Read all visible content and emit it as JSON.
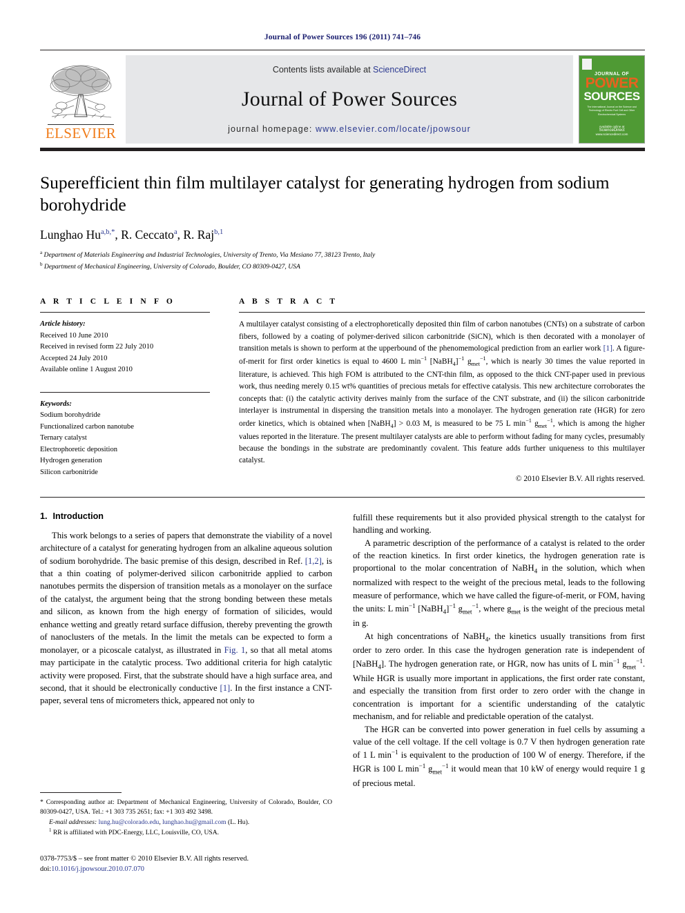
{
  "running_head": "Journal of Power Sources 196 (2011) 741–746",
  "masthead": {
    "publisher_name": "ELSEVIER",
    "contents_prefix": "Contents lists available at ",
    "sciencedirect": "ScienceDirect",
    "journal_title": "Journal of Power Sources",
    "homepage_label": "journal homepage:",
    "homepage_url": "www.elsevier.com/locate/jpowsour",
    "cover": {
      "line1": "JOURNAL OF",
      "line2": "POWER",
      "line3": "SOURCES",
      "subtitle": "The International Journal on the Science and Technology of Electro Fuel Cell and Other Electrochemical Systems",
      "footer_top": "Available online at",
      "footer_main": "ScienceDirect",
      "footer_bottom": "www.sciencedirect.com"
    }
  },
  "article": {
    "title": "Superefficient thin film multilayer catalyst for generating hydrogen from sodium borohydride",
    "authors_html": "Lunghao Hu<sup>a,b,*</sup>, R. Ceccato<sup>a</sup>, R. Raj<sup>b,1</sup>",
    "affiliations": [
      "Department of Materials Engineering and Industrial Technologies, University of Trento, Via Mesiano 77, 38123 Trento, Italy",
      "Department of Mechanical Engineering, University of Colorado, Boulder, CO 80309-0427, USA"
    ],
    "affiliation_marks": [
      "a",
      "b"
    ]
  },
  "article_info": {
    "heading": "A R T I C L E    I N F O",
    "history_label": "Article history:",
    "history": [
      "Received 10 June 2010",
      "Received in revised form 22 July 2010",
      "Accepted 24 July 2010",
      "Available online 1 August 2010"
    ],
    "keywords_label": "Keywords:",
    "keywords": [
      "Sodium borohydride",
      "Functionalized carbon nanotube",
      "Ternary catalyst",
      "Electrophoretic deposition",
      "Hydrogen generation",
      "Silicon carbonitride"
    ]
  },
  "abstract": {
    "heading": "A B S T R A C T",
    "html": "A multilayer catalyst consisting of a electrophoretically deposited thin film of carbon nanotubes (CNTs) on a substrate of carbon fibers, followed by a coating of polymer-derived silicon carbonitride (SiCN), which is then decorated with a monolayer of transition metals is shown to perform at the upperbound of the phenomemological prediction from an earlier work <a href=\"#\">[1]</a>. A figure-of-merit for first order kinetics is equal to 4600 L min<sup>−1</sup> [NaBH<sub>4</sub>]<sup>−1</sup> g<sub>met</sub><sup>−1</sup>, which is nearly 30 times the value reported in literature, is achieved. This high FOM is attributed to the CNT-thin film, as opposed to the thick CNT-paper used in previous work, thus needing merely 0.15 wt% quantities of precious metals for effective catalysis. This new architecture corroborates the concepts that: (i) the catalytic activity derives mainly from the surface of the CNT substrate, and (ii) the silicon carbonitride interlayer is instrumental in dispersing the transition metals into a monolayer. The hydrogen generation rate (HGR) for zero order kinetics, which is obtained when [NaBH<sub>4</sub>] &gt; 0.03 M, is measured to be 75 L min<sup>−1</sup> g<sub>met</sub><sup>−1</sup>, which is among the higher values reported in the literature. The present multilayer catalysts are able to perform without fading for many cycles, presumably because the bondings in the substrate are predominantly covalent. This feature adds further uniqueness to this multilayer catalyst.",
    "copyright": "© 2010 Elsevier B.V. All rights reserved."
  },
  "body": {
    "section_number": "1.",
    "section_title": "Introduction",
    "left_paragraphs": [
      "This work belongs to a series of papers that demonstrate the viability of a novel architecture of a catalyst for generating hydrogen from an alkaline aqueous solution of sodium borohydride. The basic premise of this design, described in Ref. <a href=\"#\">[1,2]</a>, is that a thin coating of polymer-derived silicon carbonitride applied to carbon nanotubes permits the dispersion of transition metals as a monolayer on the surface of the catalyst, the argument being that the strong bonding between these metals and silicon, as known from the high energy of formation of silicides, would enhance wetting and greatly retard surface diffusion, thereby preventing the growth of nanoclusters of the metals. In the limit the metals can be expected to form a monolayer, or a picoscale catalyst, as illustrated in <a href=\"#\">Fig. 1</a>, so that all metal atoms may participate in the catalytic process. Two additional criteria for high catalytic activity were proposed. First, that the substrate should have a high surface area, and second, that it should be electronically conductive <a href=\"#\">[1]</a>. In the first instance a CNT-paper, several tens of micrometers thick, appeared not only to"
    ],
    "right_paragraphs": [
      "fulfill these requirements but it also provided physical strength to the catalyst for handling and working.",
      "A parametric description of the performance of a catalyst is related to the order of the reaction kinetics. In first order kinetics, the hydrogen generation rate is proportional to the molar concentration of NaBH<sub>4</sub> in the solution, which when normalized with respect to the weight of the precious metal, leads to the following measure of performance, which we have called the figure-of-merit, or FOM, having the units: L min<sup>−1</sup> [NaBH<sub>4</sub>]<sup>−1</sup> g<sub>met</sub><sup>−1</sup>, where g<sub>met</sub> is the weight of the precious metal in g.",
      "At high concentrations of NaBH<sub>4</sub>, the kinetics usually transitions from first order to zero order. In this case the hydrogen generation rate is independent of [NaBH<sub>4</sub>]. The hydrogen generation rate, or HGR, now has units of L min<sup>−1</sup> g<sub>met</sub><sup>−1</sup>. While HGR is usually more important in applications, the first order rate constant, and especially the transition from first order to zero order with the change in concentration is important for a scientific understanding of the catalytic mechanism, and for reliable and predictable operation of the catalyst.",
      "The HGR can be converted into power generation in fuel cells by assuming a value of the cell voltage. If the cell voltage is 0.7 V then hydrogen generation rate of 1 L min<sup>−1</sup> is equivalent to the production of 100 W of energy. Therefore, if the HGR is 100 L min<sup>−1</sup> g<sub>met</sub><sup>−1</sup> it would mean that 10 kW of energy would require 1 g of precious metal."
    ]
  },
  "footnotes": {
    "corresponding_html": "* Corresponding author at: Department of Mechanical Engineering, University of Colorado, Boulder, CO 80309-0427, USA. Tel.: +1 303 735 2651; fax: +1 303 492 3498.",
    "email_html": "<em>E-mail addresses:</em> <a href=\"#\">lung.hu@colorado.edu</a>, <a href=\"#\">lunghao.hu@gmail.com</a> (L. Hu).",
    "affiliation_note_html": "<sup>1</sup> RR is affiliated with PDC-Energy, LLC, Louisville, CO, USA.",
    "issn_html": "0378-7753/$ – see front matter © 2010 Elsevier B.V. All rights reserved.",
    "doi_html": "doi:<a href=\"#\">10.1016/j.jpowsour.2010.07.070</a>"
  },
  "colors": {
    "link": "#2b3990",
    "running_head": "#181c6e",
    "elsevier_orange": "#f07c1a",
    "cover_green": "#4f9a34",
    "banner_grey": "#e6e7e9",
    "rule_dark": "#231f20"
  }
}
